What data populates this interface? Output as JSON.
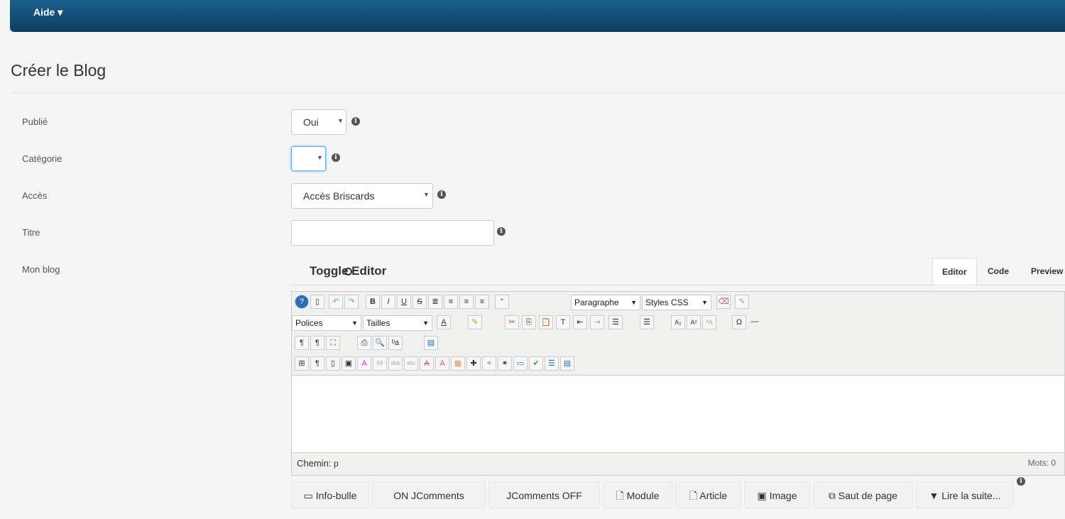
{
  "header": {
    "menu_label": "Aide"
  },
  "page": {
    "title": "Créer le Blog"
  },
  "form": {
    "published": {
      "label": "Publié",
      "value": "Oui"
    },
    "category": {
      "label": "Catégorie",
      "value": ""
    },
    "access": {
      "label": "Accès",
      "value": "Accès Briscards"
    },
    "title": {
      "label": "Titre",
      "value": ""
    },
    "blog": {
      "label": "Mon blog"
    }
  },
  "editor": {
    "toggle_label": "Toggle Editor",
    "tabs": [
      "Editor",
      "Code",
      "Preview"
    ],
    "format_select": "Paragraphe",
    "styles_select": "Styles CSS",
    "fonts_select": "Polices",
    "sizes_select": "Tailles",
    "path_label": "Chemin:",
    "path_value": "p",
    "word_count": "Mots: 0"
  },
  "buttons": [
    "Info-bulle",
    "ON JComments",
    "JComments OFF",
    "Module",
    "Article",
    "Image",
    "Saut de page",
    "Lire la suite..."
  ],
  "colors": {
    "header": "#0d3e63",
    "background": "#f5f5f5"
  }
}
